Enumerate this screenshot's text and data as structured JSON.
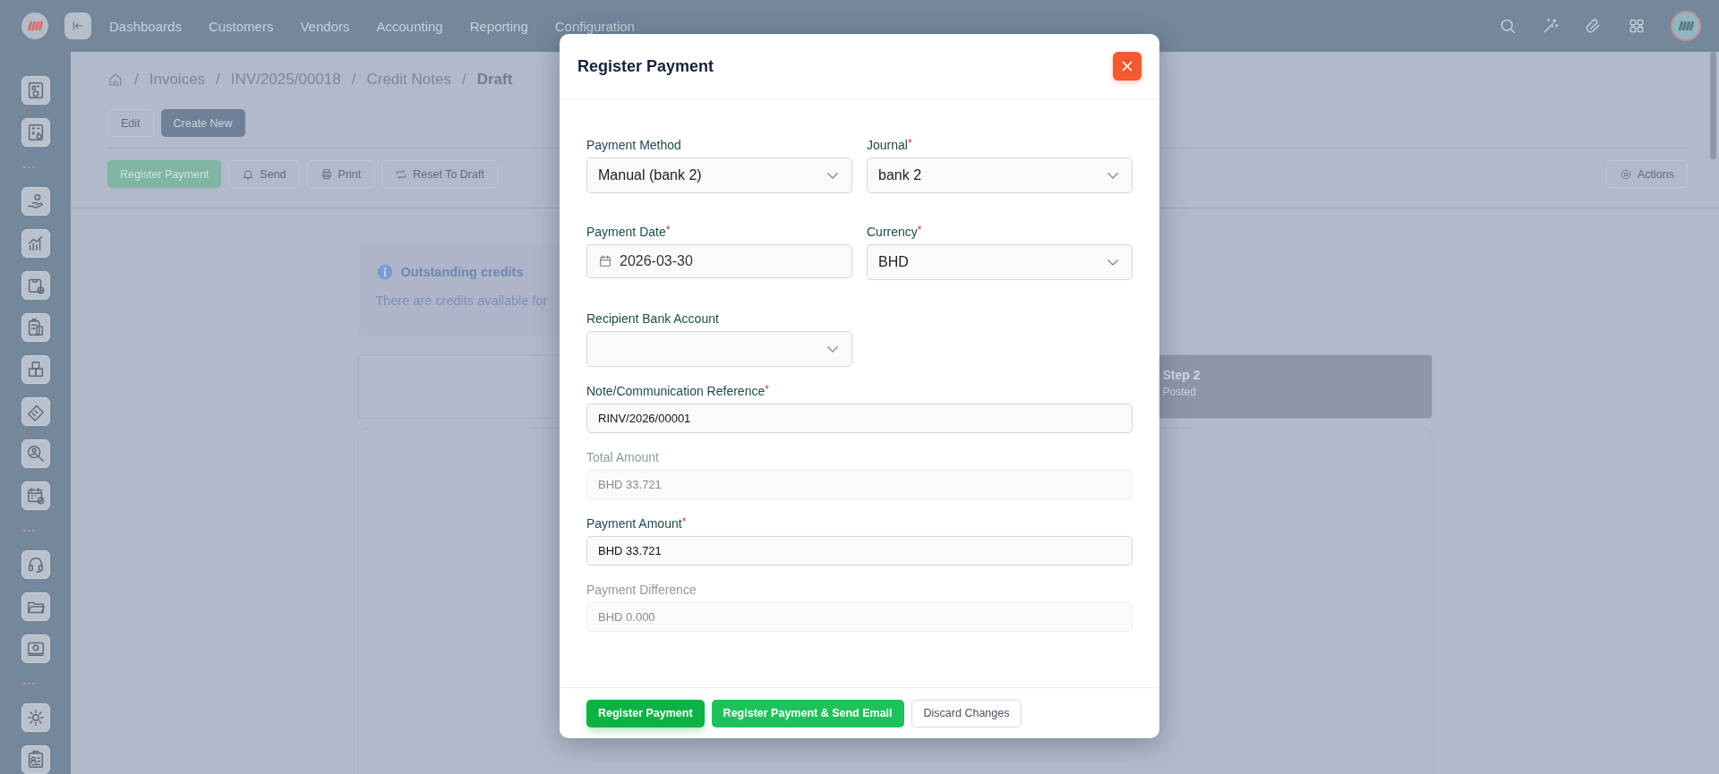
{
  "top_nav": {
    "items": [
      {
        "label": "Dashboards"
      },
      {
        "label": "Customers"
      },
      {
        "label": "Vendors"
      },
      {
        "label": "Accounting"
      },
      {
        "label": "Reporting"
      },
      {
        "label": "Configuration"
      }
    ]
  },
  "breadcrumb": [
    {
      "separator": "/",
      "label": "Invoices"
    },
    {
      "separator": "/",
      "label": "INV/2025/00018"
    },
    {
      "separator": "/",
      "label": "Credit Notes"
    },
    {
      "separator": "/",
      "label": "Draft"
    }
  ],
  "record_actions": [
    {
      "label": "Edit",
      "kind": "outline"
    },
    {
      "label": "Create New",
      "kind": "primary"
    }
  ],
  "toolbar": [
    {
      "label": "Register Payment",
      "kind": "success"
    },
    {
      "label": "Send",
      "kind": "outline"
    },
    {
      "label": "Print",
      "kind": "outline"
    },
    {
      "label": "Reset To Draft",
      "kind": "outline"
    }
  ],
  "actions_button": "Actions",
  "alert": {
    "title": "Outstanding credits",
    "text": "There are credits available for"
  },
  "steps": [
    {
      "label": "Step 2",
      "status": "Posted"
    }
  ],
  "modal": {
    "title": "Register Payment",
    "fields": [
      {
        "label": "Payment Method",
        "kind": "select",
        "value": "Manual (bank 2)",
        "disabled": false
      },
      {
        "label": "Journal",
        "required_mark": "*",
        "kind": "select",
        "value": "bank 2",
        "disabled": false
      },
      {
        "label": "Payment Date",
        "required_mark": "*",
        "kind": "date",
        "value": "2026-03-30",
        "disabled": false
      },
      {
        "label": "Currency",
        "required_mark": "*",
        "kind": "select",
        "value": "BHD",
        "disabled": false
      },
      {
        "label": "Recipient Bank Account",
        "kind": "select",
        "disabled": false
      },
      {
        "label": "Note/Communication Reference",
        "required_mark": "*",
        "kind": "text",
        "value": "RINV/2026/00001",
        "disabled": false
      },
      {
        "label": "Total Amount",
        "kind": "text",
        "value": "BHD 33.721",
        "disabled": true
      },
      {
        "label": "Payment Amount",
        "required_mark": "*",
        "kind": "text",
        "value": "BHD 33.721",
        "disabled": false
      },
      {
        "label": "Payment Difference",
        "kind": "text",
        "value": "BHD 0.000",
        "disabled": true
      }
    ],
    "buttons": [
      {
        "label": "Register Payment",
        "kind": "primary"
      },
      {
        "label": "Register Payment & Send Email",
        "kind": "secondary"
      },
      {
        "label": "Discard Changes",
        "kind": "outline"
      }
    ]
  }
}
